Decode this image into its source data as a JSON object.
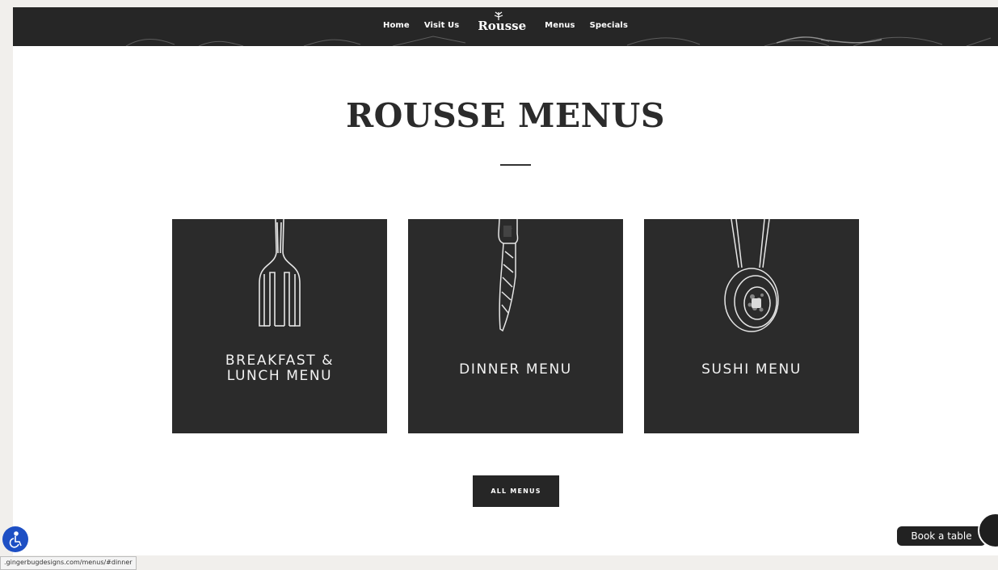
{
  "nav": {
    "links_left": [
      "Home",
      "Visit Us"
    ],
    "logo": "Rousse",
    "links_right": [
      "Menus",
      "Specials"
    ]
  },
  "page": {
    "title": "ROUSSE MENUS"
  },
  "cards": [
    {
      "label": "BREAKFAST &\nLUNCH MENU",
      "icon": "fork-icon"
    },
    {
      "label": "DINNER MENU",
      "icon": "knife-icon"
    },
    {
      "label": "SUSHI MENU",
      "icon": "sushi-icon"
    }
  ],
  "cta": {
    "all_menus": "ALL MENUS"
  },
  "widgets": {
    "book_label": "Book a table",
    "status_url": ".gingerbugdesigns.com/menus/#dinner"
  },
  "colors": {
    "nav_bg": "#262626",
    "card_bg": "#2b2b2b",
    "accessibility_blue": "#1d4fc4"
  }
}
